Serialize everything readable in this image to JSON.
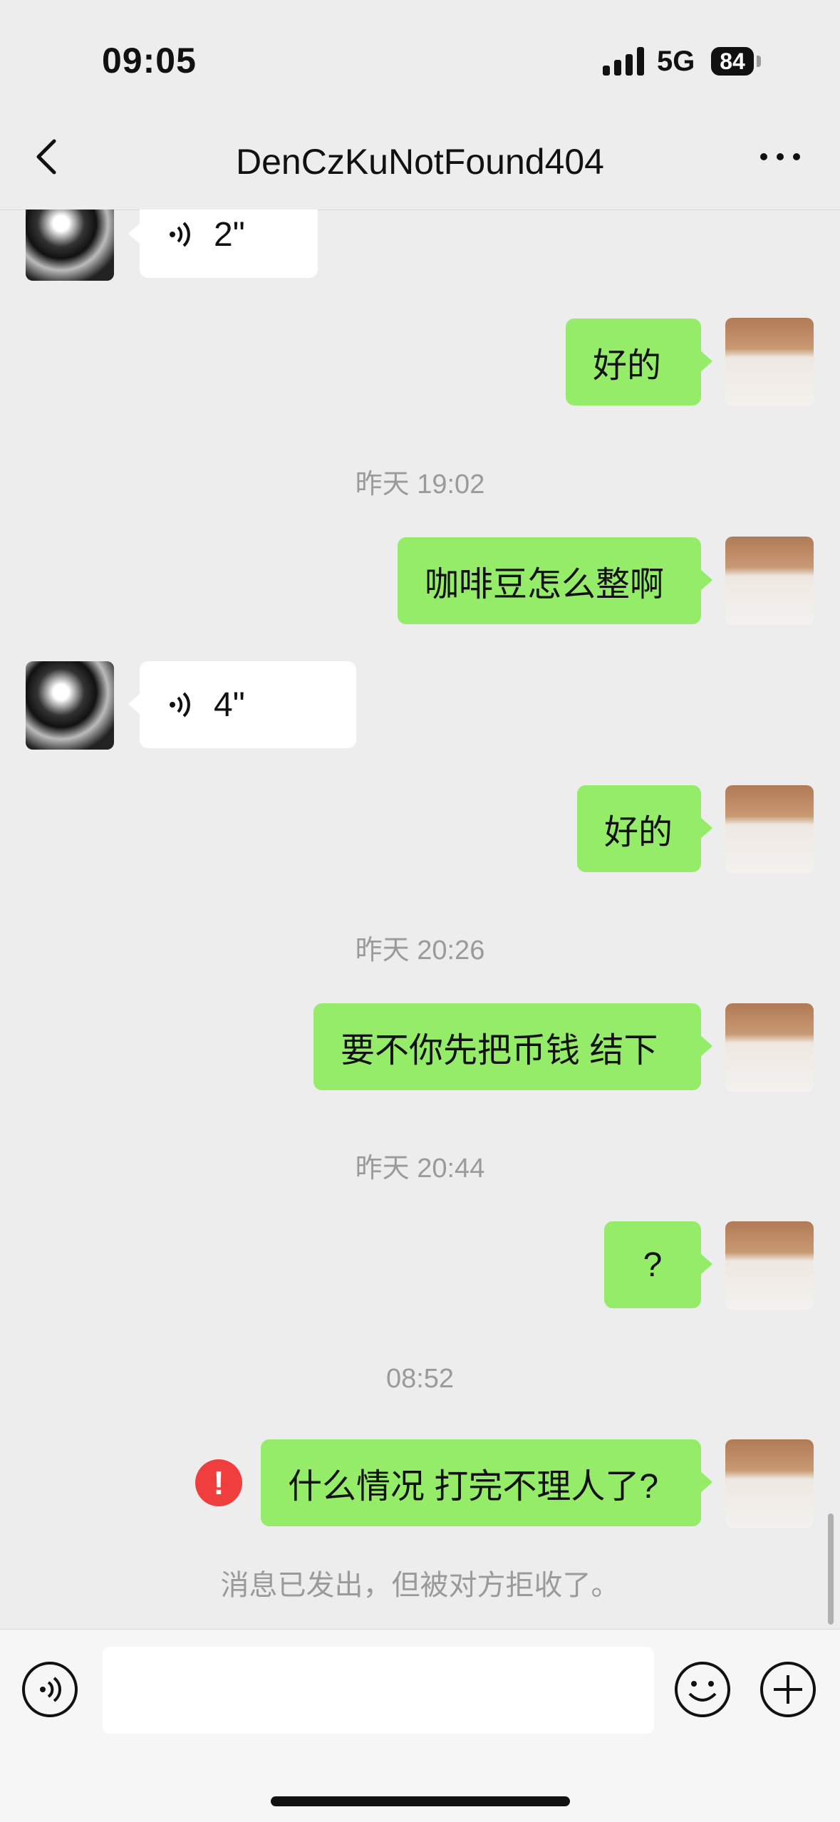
{
  "status": {
    "time": "09:05",
    "network": "5G",
    "battery": "84"
  },
  "header": {
    "title": "DenCzKuNotFound404"
  },
  "messages": {
    "voice1": "2\"",
    "m1": "好的",
    "t1": "昨天 19:02",
    "m2": "咖啡豆怎么整啊",
    "voice2": "4\"",
    "m3": "好的",
    "t2": "昨天 20:26",
    "m4": "要不你先把币钱 结下",
    "t3": "昨天 20:44",
    "m5": "?",
    "t4": "08:52",
    "m6": "什么情况 打完不理人了?",
    "error_mark": "!",
    "reject_notice": "消息已发出，但被对方拒收了。"
  },
  "colors": {
    "my_bubble": "#95ec69",
    "other_bubble": "#ffffff",
    "error": "#f03e3e",
    "background": "#ededed"
  },
  "icons": [
    "back-arrow-icon",
    "more-dots-icon",
    "voice-icon",
    "emoji-icon",
    "plus-icon",
    "error-icon"
  ]
}
